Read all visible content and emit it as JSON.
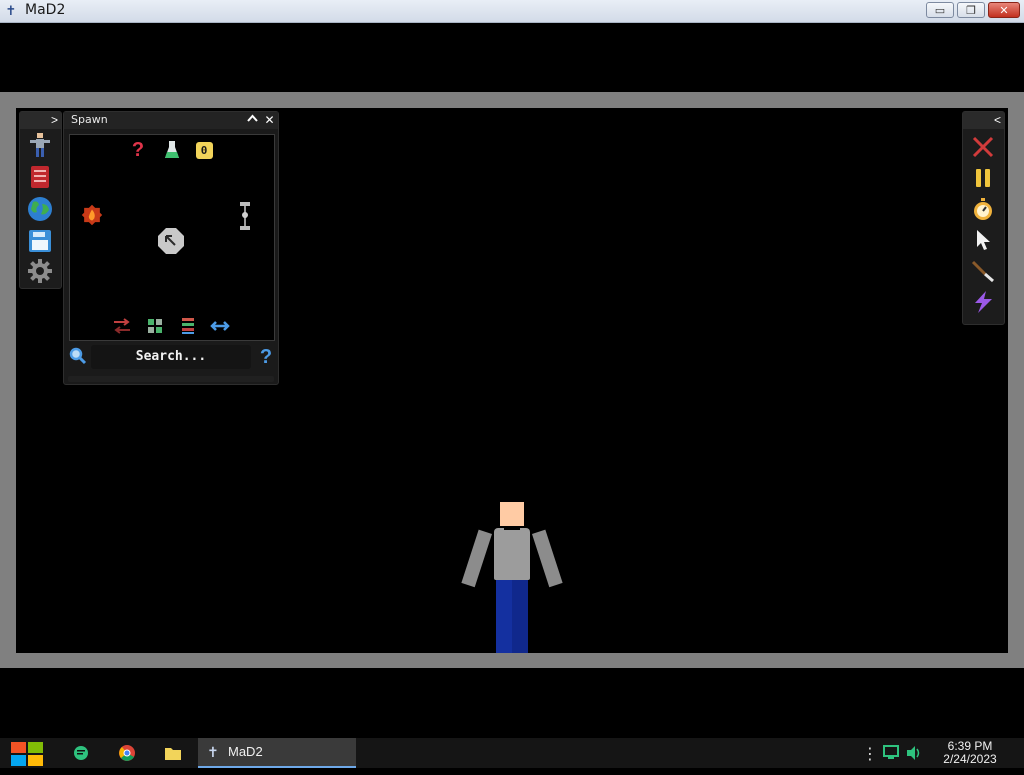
{
  "window": {
    "title": "MaD2",
    "app_icon": "ragdoll-app-icon",
    "controls": {
      "minimize": "▭",
      "restore": "❐",
      "close": "✕"
    }
  },
  "left_toolbar": {
    "expand_label": ">",
    "tools": [
      {
        "name": "ragdoll-tool-icon"
      },
      {
        "name": "book-icon"
      },
      {
        "name": "globe-icon"
      },
      {
        "name": "save-disk-icon"
      },
      {
        "name": "settings-gear-icon"
      }
    ]
  },
  "spawn_panel": {
    "title": "Spawn",
    "collapse_label": "^",
    "close_label": "✕",
    "items": [
      {
        "name": "question-mark-item-icon",
        "glyph": "?",
        "color": "#e0344a"
      },
      {
        "name": "flask-item-icon",
        "glyph": "⚗",
        "color": "#3fbf6f"
      },
      {
        "name": "counter-zero-item-icon",
        "glyph": "0",
        "color": "#1a1a1a",
        "bg": "#f2d45a"
      },
      {
        "name": "fire-item-icon",
        "glyph": "🔥",
        "color": "#ff7a2a"
      },
      {
        "name": "pin-connector-item-icon",
        "glyph": "⫶",
        "color": "#c8c8c8"
      },
      {
        "name": "spawn-arrow-item-icon",
        "glyph": "⇱",
        "color": "#333"
      }
    ],
    "filters": [
      {
        "name": "swap-filter-icon",
        "glyph": "⇄",
        "color": "#c14040"
      },
      {
        "name": "grid-filter-icon",
        "glyph": "▦",
        "color": "#4ab46c"
      },
      {
        "name": "list-filter-icon",
        "glyph": "☰",
        "color": "#d0584a"
      },
      {
        "name": "resize-filter-icon",
        "glyph": "⟷",
        "color": "#4c9be6"
      }
    ],
    "search": {
      "placeholder": "Search...",
      "search_icon": "🔍",
      "help_label": "?"
    }
  },
  "right_toolbar": {
    "collapse_label": "<",
    "tools": [
      {
        "name": "clear-x-icon",
        "glyph": "✕",
        "color": "#d23b3b"
      },
      {
        "name": "pause-icon",
        "glyph": "❚❚",
        "color": "#f0c53c"
      },
      {
        "name": "stopwatch-icon",
        "glyph": "⏱",
        "color": "#f0b23c"
      },
      {
        "name": "pointer-cursor-icon",
        "glyph": "➤",
        "color": "#f2f2f2"
      },
      {
        "name": "knife-icon",
        "glyph": "╱",
        "color": "#d27a3a"
      },
      {
        "name": "lightning-icon",
        "glyph": "⚡",
        "color": "#9b59e8"
      }
    ]
  },
  "colors": {
    "viewport_frame": "#808080",
    "skin": "#ffcba4",
    "shirt": "#9c9c9c",
    "pants": "#1430a0",
    "taskbar": "#151515"
  },
  "taskbar": {
    "app_label": "MaD2",
    "time": "6:39 PM",
    "date": "2/24/2023",
    "pinned": [
      {
        "name": "messaging-app-icon",
        "glyph": "●",
        "color": "#2ec27e"
      },
      {
        "name": "chrome-icon",
        "glyph": "◉",
        "color": "#e8b030"
      },
      {
        "name": "file-explorer-icon",
        "glyph": "▬",
        "color": "#f2d45a"
      }
    ],
    "tray": [
      {
        "name": "overflow-dots-icon",
        "glyph": "⋮"
      },
      {
        "name": "network-icon",
        "glyph": "🖥"
      },
      {
        "name": "volume-icon",
        "glyph": "🔊"
      }
    ]
  }
}
